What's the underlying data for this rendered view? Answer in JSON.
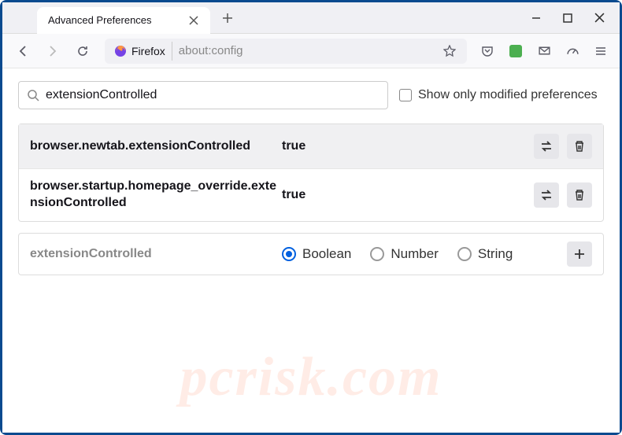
{
  "tab": {
    "title": "Advanced Preferences"
  },
  "addressbar": {
    "identity": "Firefox",
    "url": "about:config"
  },
  "search": {
    "value": "extensionControlled",
    "filter_label": "Show only modified preferences"
  },
  "prefs": [
    {
      "name": "browser.newtab.extensionControlled",
      "value": "true"
    },
    {
      "name": "browser.startup.homepage_override.extensionControlled",
      "value": "true"
    }
  ],
  "new_pref": {
    "name": "extensionControlled",
    "types": {
      "boolean": "Boolean",
      "number": "Number",
      "string": "String"
    }
  },
  "watermark": "pcrisk.com"
}
